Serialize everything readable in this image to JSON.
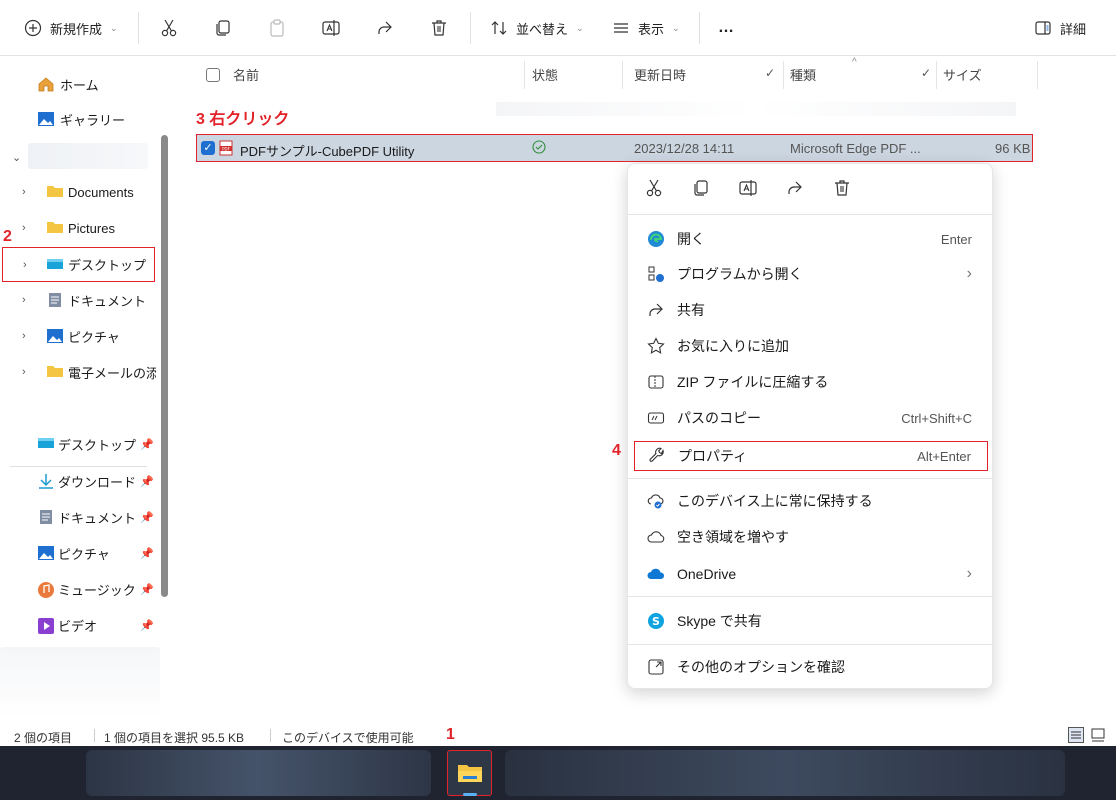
{
  "toolbar": {
    "new_label": "新規作成",
    "sort_label": "並べ替え",
    "view_label": "表示",
    "more_label": "…",
    "details_label": "詳細"
  },
  "sidebar": {
    "quick": [
      {
        "label": "ホーム"
      },
      {
        "label": "ギャラリー"
      }
    ],
    "tree": [
      {
        "label": "Documents"
      },
      {
        "label": "Pictures"
      },
      {
        "label": "デスクトップ"
      },
      {
        "label": "ドキュメント"
      },
      {
        "label": "ピクチャ"
      },
      {
        "label": "電子メールの添付"
      }
    ],
    "pinned": [
      {
        "label": "デスクトップ"
      },
      {
        "label": "ダウンロード"
      },
      {
        "label": "ドキュメント"
      },
      {
        "label": "ピクチャ"
      },
      {
        "label": "ミュージック"
      },
      {
        "label": "ビデオ"
      }
    ]
  },
  "columns": {
    "name": "名前",
    "status": "状態",
    "modified": "更新日時",
    "type": "種類",
    "size": "サイズ"
  },
  "file": {
    "name": "PDFサンプル-CubePDF Utility",
    "modified": "2023/12/28 14:11",
    "type": "Microsoft Edge PDF ...",
    "size": "96 KB"
  },
  "context_menu": {
    "items": [
      {
        "label": "開く",
        "shortcut": "Enter"
      },
      {
        "label": "プログラムから開く",
        "shortcut": "›"
      },
      {
        "label": "共有",
        "shortcut": ""
      },
      {
        "label": "お気に入りに追加",
        "shortcut": ""
      },
      {
        "label": "ZIP ファイルに圧縮する",
        "shortcut": ""
      },
      {
        "label": "パスのコピー",
        "shortcut": "Ctrl+Shift+C"
      },
      {
        "label": "プロパティ",
        "shortcut": "Alt+Enter"
      },
      {
        "label": "このデバイス上に常に保持する",
        "shortcut": ""
      },
      {
        "label": "空き領域を増やす",
        "shortcut": ""
      },
      {
        "label": "OneDrive",
        "shortcut": "›"
      },
      {
        "label": "Skype で共有",
        "shortcut": ""
      },
      {
        "label": "その他のオプションを確認",
        "shortcut": ""
      }
    ]
  },
  "statusbar": {
    "items_count": "2 個の項目",
    "selected": "1 個の項目を選択  95.5 KB",
    "availability": "このデバイスで使用可能"
  },
  "annotations": {
    "step1": "1",
    "step2": "2",
    "step3": "3 右クリック",
    "step4": "4"
  },
  "colors": {
    "accent_red": "#e2242a",
    "selection": "#ccd6e1",
    "folder_yellow": "#f4c542",
    "blue": "#1f6fd1"
  }
}
